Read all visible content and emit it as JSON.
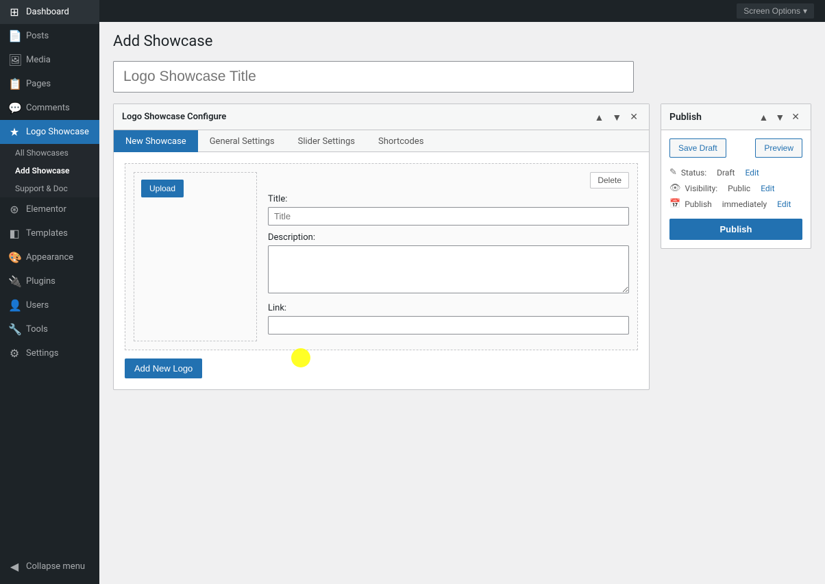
{
  "topbar": {
    "screen_options_label": "Screen Options",
    "screen_options_arrow": "▾"
  },
  "sidebar": {
    "items": [
      {
        "id": "dashboard",
        "label": "Dashboard",
        "icon": "⊞"
      },
      {
        "id": "posts",
        "label": "Posts",
        "icon": "📄"
      },
      {
        "id": "media",
        "label": "Media",
        "icon": "🖼"
      },
      {
        "id": "pages",
        "label": "Pages",
        "icon": "📋"
      },
      {
        "id": "comments",
        "label": "Comments",
        "icon": "💬"
      },
      {
        "id": "logo-showcase",
        "label": "Logo Showcase",
        "icon": "★",
        "active": true
      },
      {
        "id": "elementor",
        "label": "Elementor",
        "icon": "⊛"
      },
      {
        "id": "templates",
        "label": "Templates",
        "icon": "◧"
      },
      {
        "id": "appearance",
        "label": "Appearance",
        "icon": "🎨"
      },
      {
        "id": "plugins",
        "label": "Plugins",
        "icon": "🔌"
      },
      {
        "id": "users",
        "label": "Users",
        "icon": "👤"
      },
      {
        "id": "tools",
        "label": "Tools",
        "icon": "🔧"
      },
      {
        "id": "settings",
        "label": "Settings",
        "icon": "⚙"
      }
    ],
    "sub_items": [
      {
        "id": "all-showcases",
        "label": "All Showcases"
      },
      {
        "id": "add-showcase",
        "label": "Add Showcase",
        "current": true
      },
      {
        "id": "support-doc",
        "label": "Support & Doc"
      }
    ],
    "collapse_label": "Collapse menu"
  },
  "page": {
    "title": "Add Showcase"
  },
  "title_input": {
    "placeholder": "Logo Showcase Title",
    "value": ""
  },
  "configure_box": {
    "title": "Logo Showcase Configure",
    "tabs": [
      {
        "id": "new-showcase",
        "label": "New Showcase",
        "active": true
      },
      {
        "id": "general-settings",
        "label": "General Settings"
      },
      {
        "id": "slider-settings",
        "label": "Slider Settings"
      },
      {
        "id": "shortcodes",
        "label": "Shortcodes"
      }
    ],
    "logo_item": {
      "upload_btn": "Upload",
      "delete_btn": "Delete",
      "title_label": "Title:",
      "title_placeholder": "Title",
      "description_label": "Description:",
      "description_placeholder": "",
      "link_label": "Link:",
      "link_placeholder": ""
    },
    "add_new_logo_btn": "Add New Logo"
  },
  "publish_box": {
    "title": "Publish",
    "save_draft_btn": "Save Draft",
    "preview_btn": "Preview",
    "status_label": "Status:",
    "status_value": "Draft",
    "status_edit_link": "Edit",
    "visibility_label": "Visibility:",
    "visibility_value": "Public",
    "visibility_edit_link": "Edit",
    "publish_time_label": "Publish",
    "publish_time_value": "immediately",
    "publish_time_edit_link": "Edit",
    "publish_btn": "Publish"
  }
}
